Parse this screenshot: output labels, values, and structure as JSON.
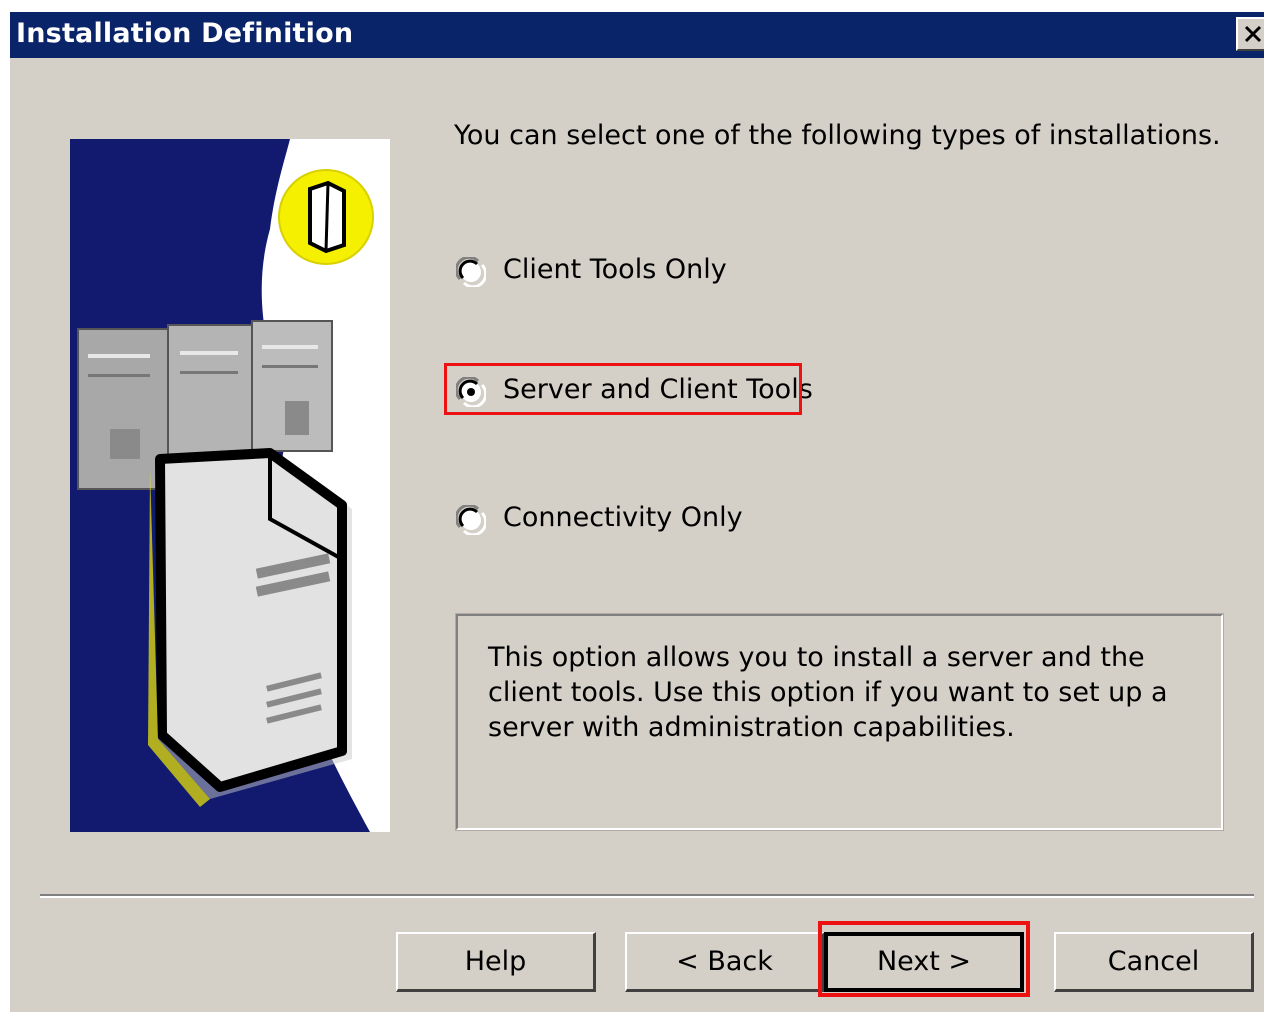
{
  "window": {
    "title": "Installation Definition",
    "close_glyph": "✕"
  },
  "content": {
    "prompt": "You can select one of the following types of installations.",
    "options": [
      {
        "label": "Client Tools Only",
        "selected": false
      },
      {
        "label": "Server and Client Tools",
        "selected": true
      },
      {
        "label": "Connectivity Only",
        "selected": false
      }
    ],
    "description": "This option allows you to install a server and the client tools. Use this option if you want to set up a server with administration capabilities."
  },
  "buttons": {
    "help": "Help",
    "back": "< Back",
    "next": "Next >",
    "cancel": "Cancel"
  },
  "colors": {
    "titlebar": "#0a246a",
    "dialog_face": "#d4d0c8",
    "highlight": "#ee1111",
    "art_blue": "#111a6e",
    "art_yellow": "#f5f000"
  },
  "icons": {
    "close": "close-icon",
    "art": "server-illustration",
    "radio": "radio-button-icon"
  }
}
